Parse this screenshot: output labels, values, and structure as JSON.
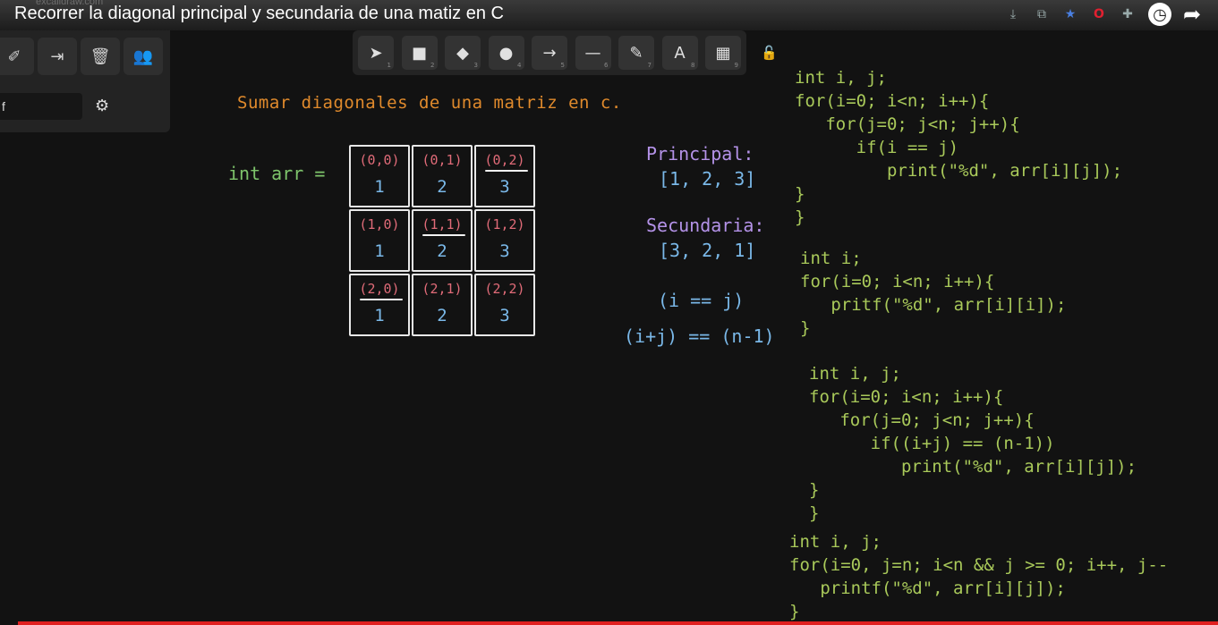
{
  "browser": {
    "url_ghost": "excalidraw.com"
  },
  "video": {
    "title": "Recorrer la diagonal principal y secundaria de una matiz en C",
    "progress_fraction": 1.0
  },
  "top_icons": [
    "download-icon",
    "translate-icon",
    "star-icon",
    "opera-icon",
    "extensions-icon",
    "watch-later-icon",
    "share-icon"
  ],
  "left_panel": {
    "buttons": [
      "paint-format-icon",
      "export-icon",
      "trash-icon",
      "collaborators-icon"
    ],
    "input_value": "f",
    "gear": "gear-icon"
  },
  "toolbar": {
    "tools": [
      {
        "name": "selection",
        "glyph": "➤",
        "key": "1"
      },
      {
        "name": "rectangle",
        "glyph": "■",
        "key": "2"
      },
      {
        "name": "diamond",
        "glyph": "◆",
        "key": "3"
      },
      {
        "name": "ellipse",
        "glyph": "●",
        "key": "4"
      },
      {
        "name": "arrow",
        "glyph": "→",
        "key": "5"
      },
      {
        "name": "line",
        "glyph": "—",
        "key": "6"
      },
      {
        "name": "draw",
        "glyph": "✎",
        "key": "7"
      },
      {
        "name": "text",
        "glyph": "A",
        "key": "8"
      },
      {
        "name": "library",
        "glyph": "▦",
        "key": "9"
      }
    ],
    "lock_glyph": "🔓"
  },
  "canvas": {
    "heading": "Sumar diagonales de una matriz en c.",
    "arr_label": "int arr =",
    "matrix": [
      [
        {
          "idx": "(0,0)",
          "val": "1"
        },
        {
          "idx": "(0,1)",
          "val": "2"
        },
        {
          "idx": "(0,2)",
          "val": "3"
        }
      ],
      [
        {
          "idx": "(1,0)",
          "val": "1"
        },
        {
          "idx": "(1,1)",
          "val": "2"
        },
        {
          "idx": "(1,2)",
          "val": "3"
        }
      ],
      [
        {
          "idx": "(2,0)",
          "val": "1"
        },
        {
          "idx": "(2,1)",
          "val": "2"
        },
        {
          "idx": "(2,2)",
          "val": "3"
        }
      ]
    ],
    "principal_label": "Principal:",
    "principal_values": "[1, 2, 3]",
    "secundaria_label": "Secundaria:",
    "secundaria_values": "[3, 2, 1]",
    "cond_principal": "(i == j)",
    "cond_secundaria": "(i+j) == (n-1)",
    "code_blocks": [
      [
        "int i, j;",
        "for(i=0; i<n; i++){",
        "   for(j=0; j<n; j++){",
        "      if(i == j)",
        "         print(\"%d\", arr[i][j]);",
        "}",
        "}"
      ],
      [
        "int i;",
        "for(i=0; i<n; i++){",
        "   pritf(\"%d\", arr[i][i]);",
        "}"
      ],
      [
        "int i, j;",
        "for(i=0; i<n; i++){",
        "   for(j=0; j<n; j++){",
        "      if((i+j) == (n-1))",
        "         print(\"%d\", arr[i][j]);",
        "}",
        "}"
      ],
      [
        "int i, j;",
        "for(i=0, j=n; i<n && j >= 0; i++, j--",
        "   printf(\"%d\", arr[i][j]);",
        "}"
      ]
    ]
  }
}
